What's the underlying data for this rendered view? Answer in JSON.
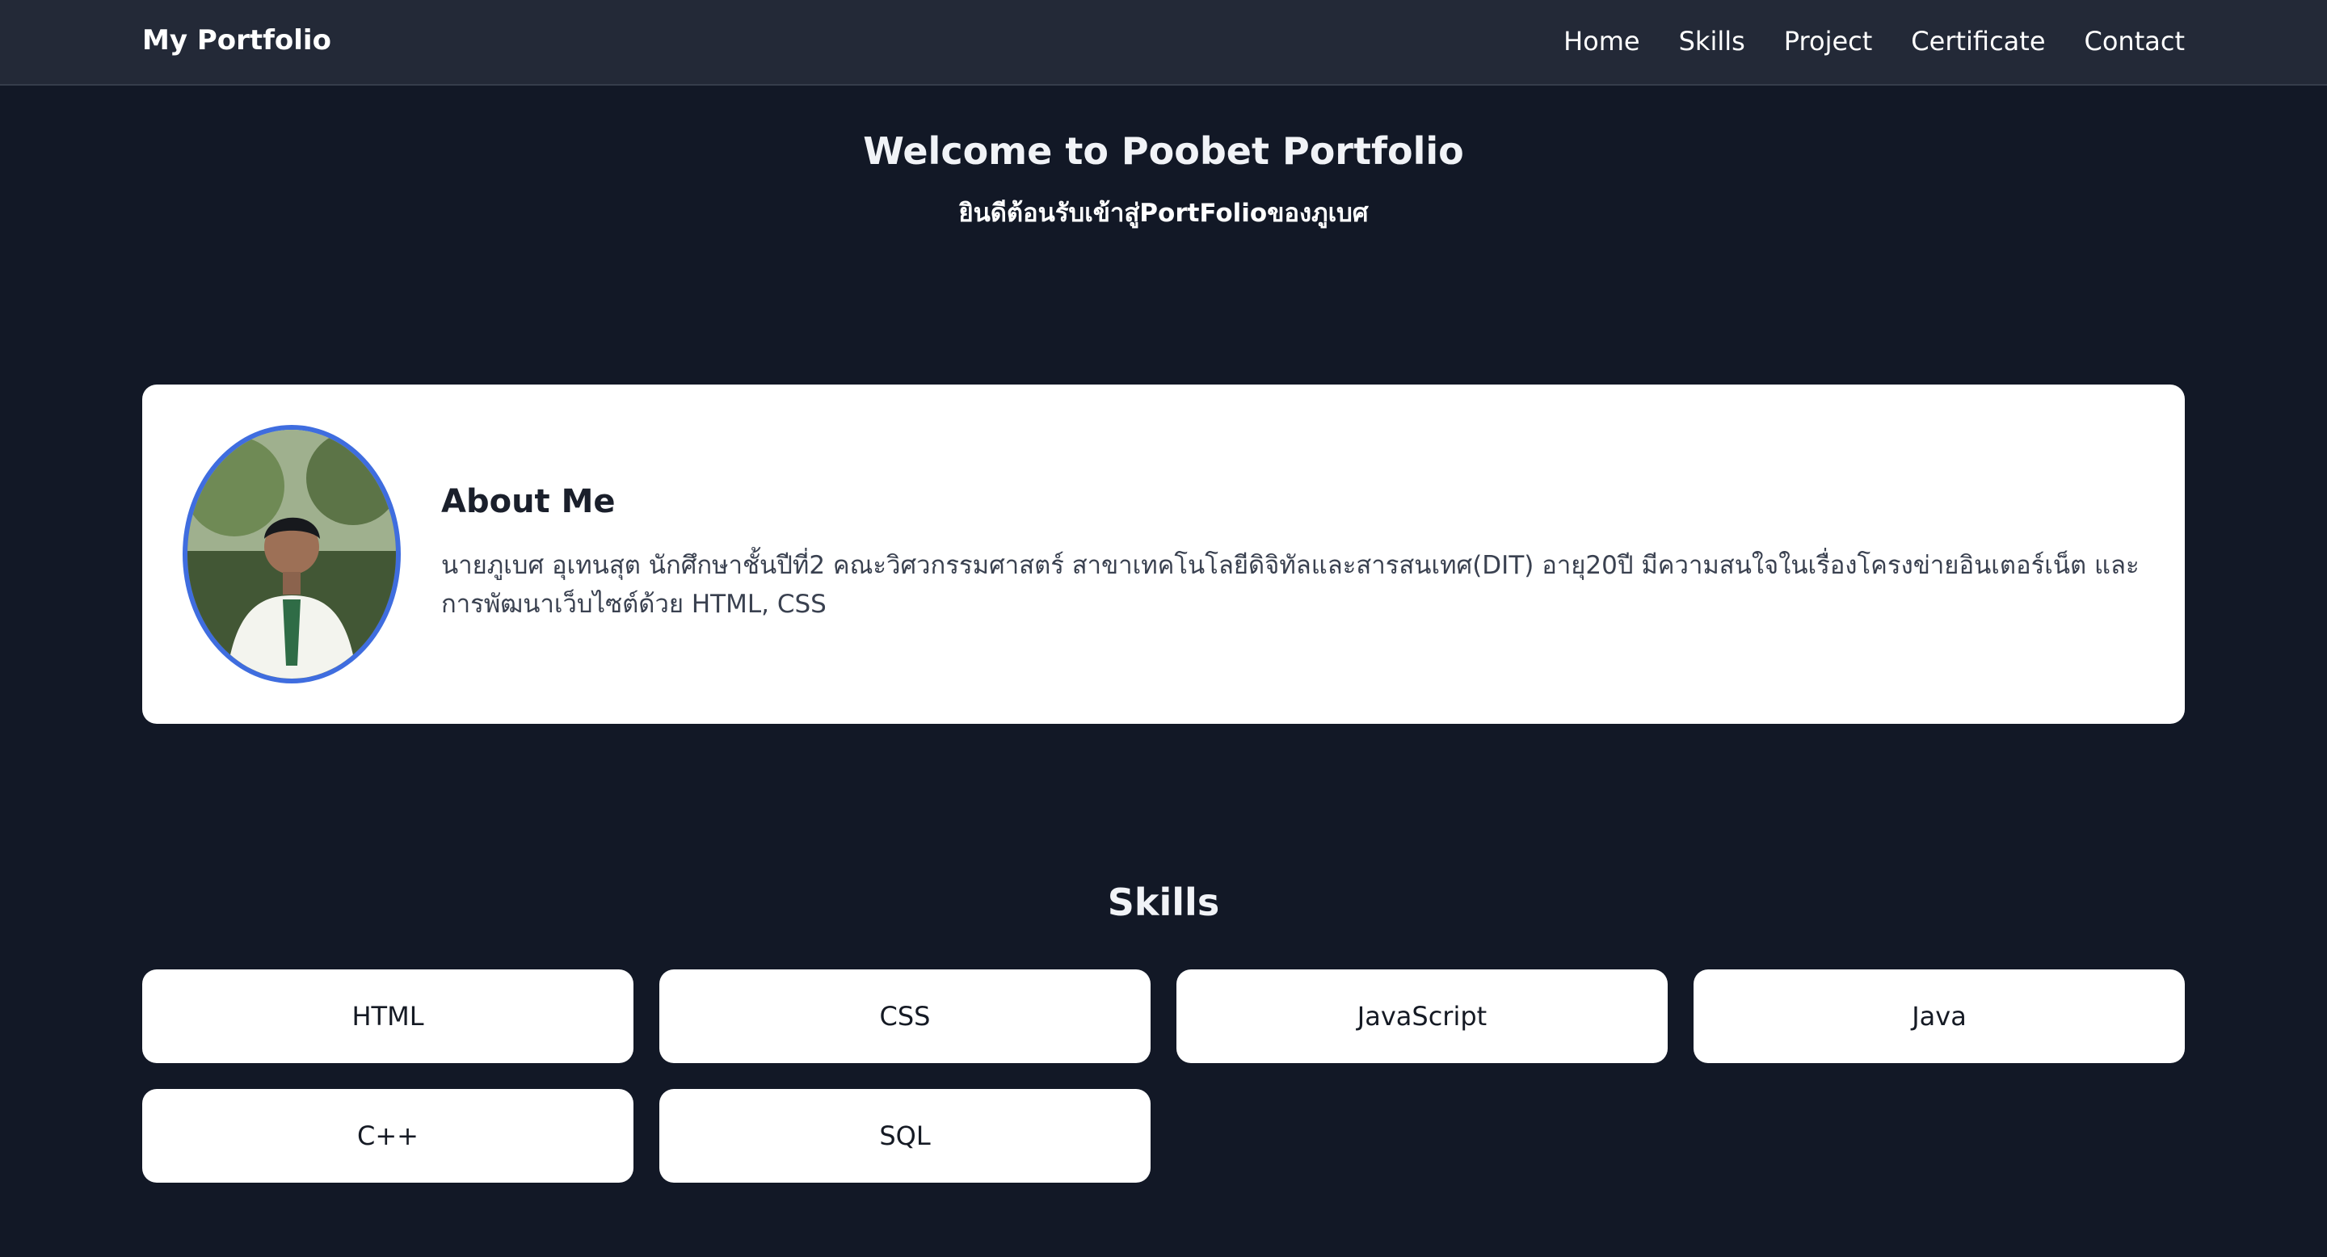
{
  "nav": {
    "brand": "My Portfolio",
    "links": [
      "Home",
      "Skills",
      "Project",
      "Certificate",
      "Contact"
    ]
  },
  "hero": {
    "title": "Welcome to Poobet Portfolio",
    "subtitle": "ยินดีต้อนรับเข้าสู่PortFolioของภูเบศ"
  },
  "about": {
    "title": "About Me",
    "text": "นายภูเบศ อุเทนสุต นักศึกษาชั้นปีที่2 คณะวิศวกรรมศาสตร์ สาขาเทคโนโลยีดิจิทัลและสารสนเทศ(DIT) อายุ20ปี มีความสนใจในเรื่องโครงข่ายอินเตอร์เน็ต และการพัฒนาเว็บไซต์ด้วย HTML, CSS"
  },
  "skills": {
    "title": "Skills",
    "items": [
      "HTML",
      "CSS",
      "JavaScript",
      "Java",
      "C++",
      "SQL"
    ]
  },
  "colors": {
    "page_background": "#121826",
    "navbar_background": "#232937",
    "card_background": "#ffffff",
    "avatar_border": "#3f6ddf"
  }
}
